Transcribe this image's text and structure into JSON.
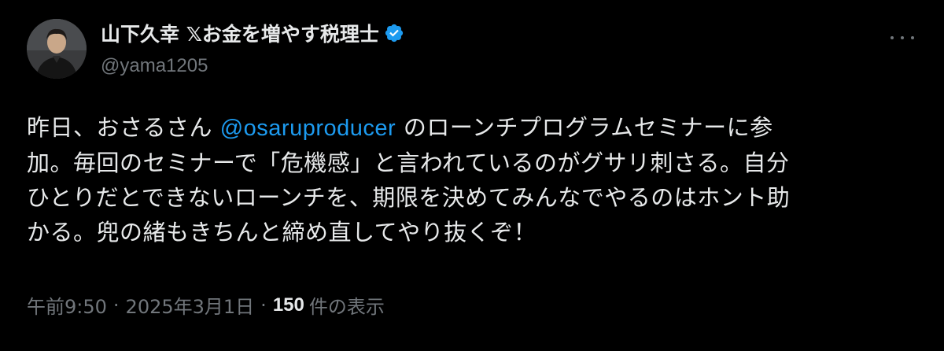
{
  "author": {
    "display_name": "山下久幸 𝕏お金を増やす税理士",
    "handle": "@yama1205",
    "verified": true
  },
  "tweet": {
    "lines": [
      {
        "before": "昨日、おさるさん ",
        "mention": "@osaruproducer",
        "after": " のローンチプログラムセミナーに参"
      },
      {
        "text": "加。毎回のセミナーで「危機感」と言われているのがグサリ刺さる。自分"
      },
      {
        "text": "ひとりだとできないローンチを、期限を決めてみんなでやるのはホント助"
      },
      {
        "text": "かる。兜の緒もきちんと締め直してやり抜くぞ！"
      }
    ]
  },
  "meta": {
    "time": "午前9:50",
    "separator": "·",
    "date": "2025年3月1日",
    "views_count": "150",
    "views_label": "件の表示"
  },
  "colors": {
    "background": "#000000",
    "text": "#e7e9ea",
    "secondary": "#71767b",
    "accent": "#1d9bf0"
  },
  "icons": {
    "verified": "verified-badge-icon",
    "more": "more-options-icon"
  }
}
